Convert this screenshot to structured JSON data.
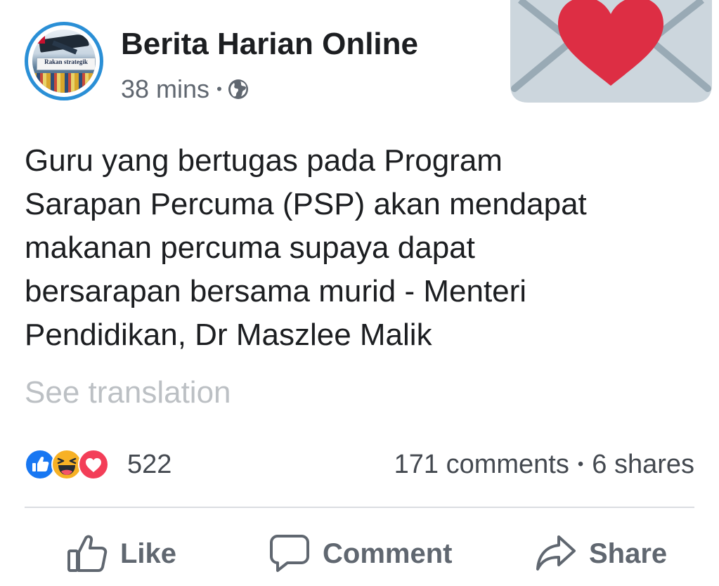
{
  "post": {
    "page_name": "Berita Harian Online",
    "timestamp": "38 mins",
    "meta_separator": "•",
    "privacy_icon": "globe-icon",
    "avatar_banner_text": "Rakan strategik",
    "text_lines": [
      "Guru yang bertugas pada Program",
      "Sarapan Percuma (PSP) akan mendapat",
      "makanan percuma supaya dapat",
      "bersarapan bersama murid - Menteri",
      "Pendidikan, Dr Maszlee Malik"
    ],
    "see_translation": "See translation"
  },
  "sticker": {
    "icon": "love-letter-icon",
    "envelope_color": "#ccd6dd",
    "heart_color": "#dd2e44"
  },
  "engagement": {
    "reaction_icons": [
      "like-reaction-icon",
      "haha-reaction-icon",
      "love-reaction-icon"
    ],
    "reaction_count": "522",
    "comments": "171 comments",
    "separator": "•",
    "shares": "6 shares"
  },
  "actions": {
    "like": "Like",
    "comment": "Comment",
    "share": "Share"
  },
  "colors": {
    "accent_blue": "#1877f2",
    "text_primary": "#1c1e21",
    "text_secondary": "#606770",
    "text_muted": "#bcc0c4",
    "avatar_ring": "#2a8fd6"
  }
}
